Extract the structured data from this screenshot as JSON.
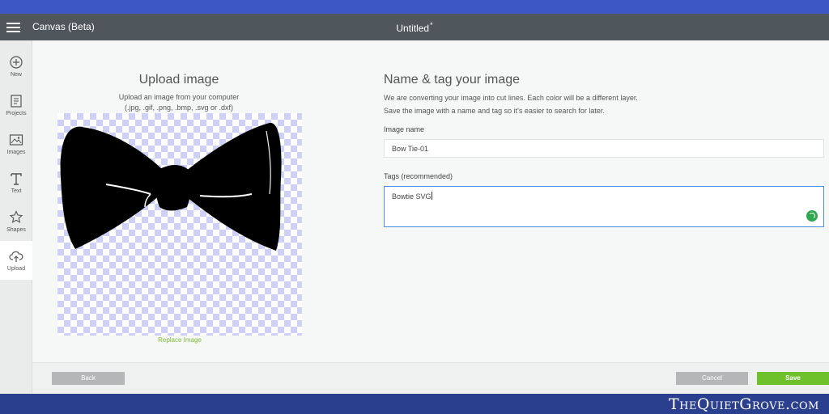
{
  "header": {
    "app_title": "Canvas (Beta)",
    "doc_title": "Untitled",
    "doc_unsaved_mark": "*"
  },
  "sidebar": {
    "items": [
      {
        "label": "New",
        "icon": "plus-circle-icon"
      },
      {
        "label": "Projects",
        "icon": "projects-icon"
      },
      {
        "label": "Images",
        "icon": "image-icon"
      },
      {
        "label": "Text",
        "icon": "text-icon"
      },
      {
        "label": "Shapes",
        "icon": "shapes-icon"
      },
      {
        "label": "Upload",
        "icon": "cloud-upload-icon",
        "active": true
      }
    ]
  },
  "upload": {
    "title": "Upload image",
    "subtitle_line1": "Upload an image from your computer",
    "subtitle_line2": "(.jpg, .gif, .png, .bmp, .svg or .dxf)",
    "replace_link": "Replace Image",
    "preview": "bow-tie-silhouette"
  },
  "name_tag": {
    "title": "Name & tag your image",
    "desc_line1": "We are converting your image into cut lines. Each color will be a different layer.",
    "desc_line2": "Save the image with a name and tag so it's easier to search for later.",
    "image_name_label": "Image name",
    "image_name_value": "Bow Tie-01",
    "tags_label": "Tags (recommended)",
    "tags_value": "Bowtie SVG"
  },
  "footer": {
    "back_label": "Back",
    "cancel_label": "Cancel",
    "save_label": "Save"
  },
  "watermark": "TheQuietGrove.com",
  "colors": {
    "header_bg": "#4f565c",
    "save_button": "#6fc12c",
    "link": "#7fba3a",
    "focus_border": "#4a90e2",
    "spinner": "#2fa84f",
    "top_band": "#3d57c4",
    "bottom_band": "#2b3f8f"
  }
}
